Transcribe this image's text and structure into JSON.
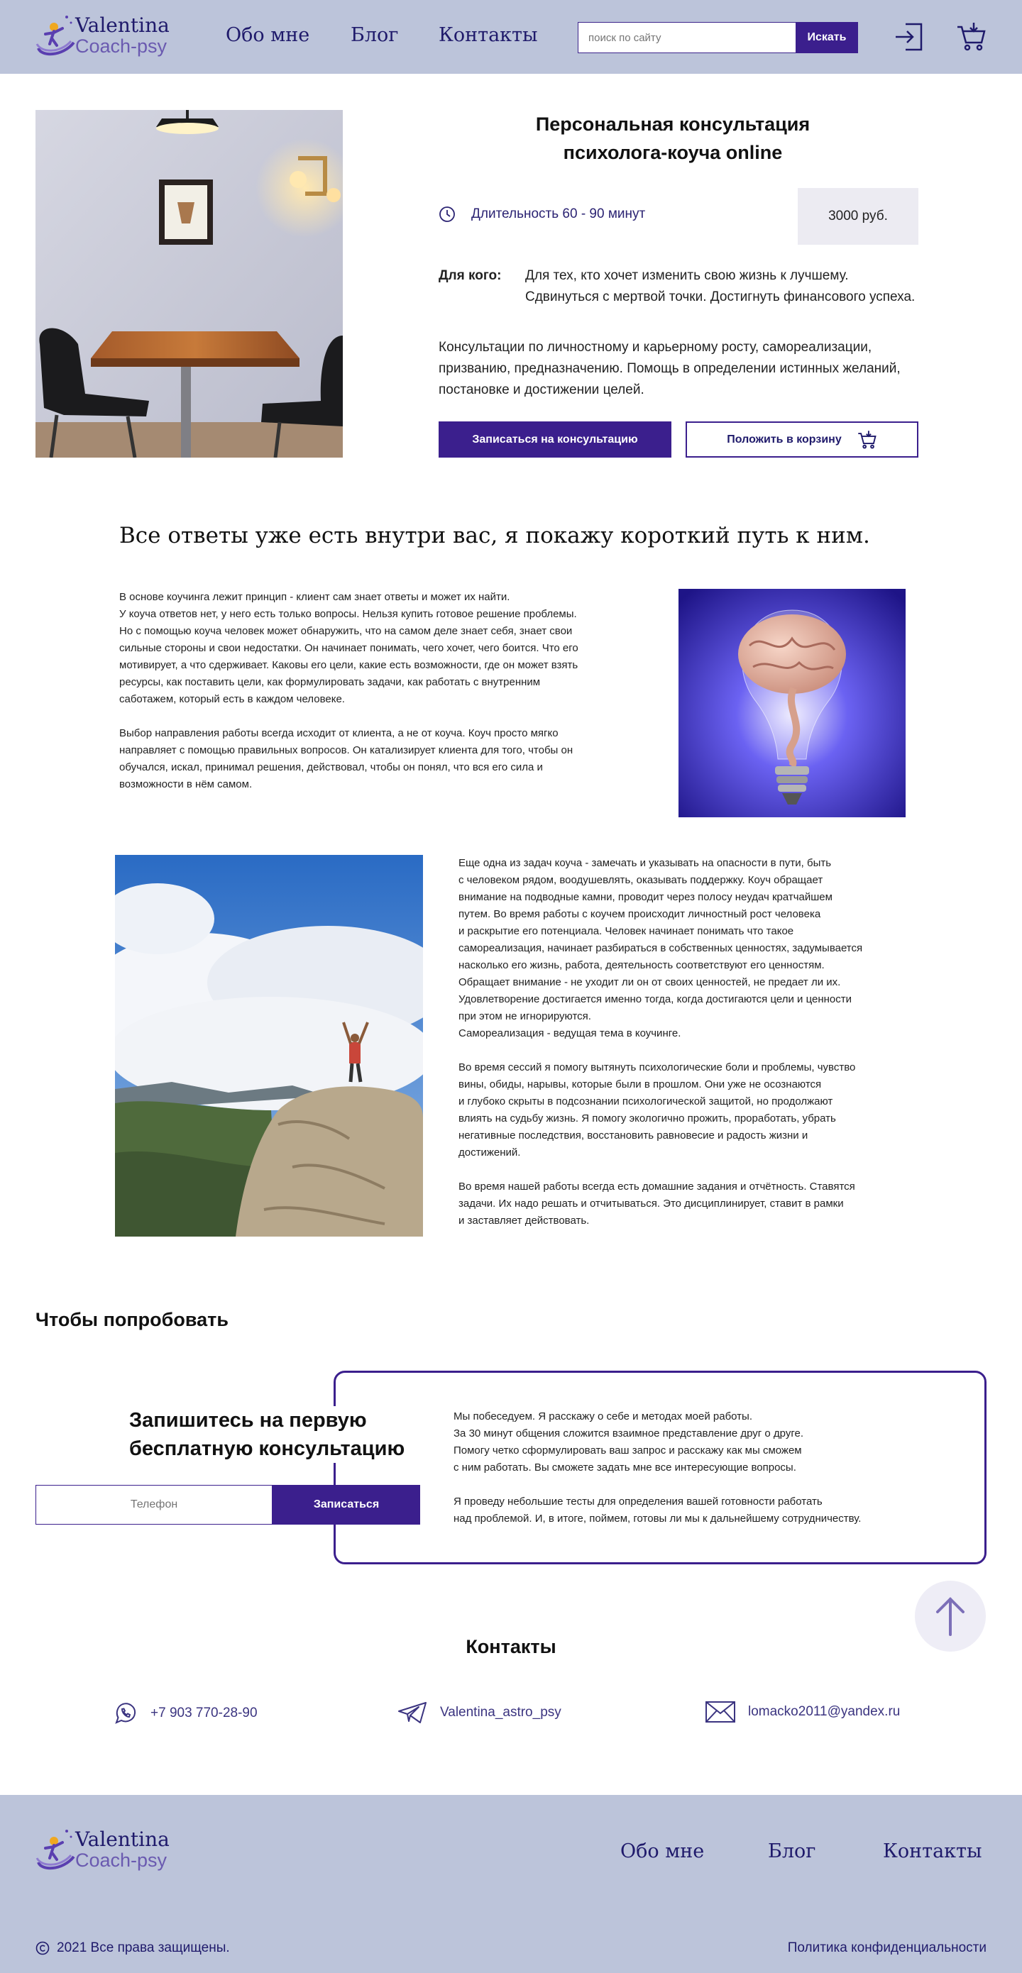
{
  "brand": {
    "name_line1": "Valentina",
    "name_line2": "Coach-psy"
  },
  "nav": {
    "about": "Обо мне",
    "blog": "Блог",
    "contacts": "Контакты"
  },
  "search": {
    "placeholder": "поиск по сайту",
    "button": "Искать"
  },
  "product": {
    "title_line1": "Персональная консультация",
    "title_line2": "психолога-коуча online",
    "duration": "Длительность 60 - 90 минут",
    "price": "3000 руб.",
    "for_whom_label": "Для кого:",
    "for_whom_text": "Для тех, кто хочет изменить свою жизнь к лучшему. Сдвинуться с мертвой точки. Достигнуть финансового успеха.",
    "description": "Консультации по личностному и карьерному росту, самореализации, призванию, предназначению. Помощь в определении истинных желаний, постановке и достижении целей.",
    "book_button": "Записаться на консультацию",
    "cart_button": "Положить в корзину"
  },
  "about": {
    "heading": "Все ответы уже есть внутри вас,  я покажу короткий путь к ним.",
    "para1": "В основе коучинга лежит принцип - клиент сам знает ответы и может их найти.\n У коуча ответов нет, у него есть только вопросы. Нельзя купить готовое решение проблемы.\nНо с помощью коуча человек может обнаружить, что на самом деле знает себя, знает свои\nсильные стороны и свои недостатки. Он начинает понимать, чего хочет, чего боится. Что его\nмотивирует, а что сдерживает. Каковы его цели, какие есть возможности, где он может взять\nресурсы, как поставить цели, как формулировать задачи, как работать с внутренним\nсаботажем, который есть в каждом человеке.",
    "para2": "Выбор направления работы всегда исходит от клиента, а не от коуча. Коуч просто мягко\nнаправляет с помощью правильных вопросов. Он катализирует клиента для того, чтобы он\nобучался, искал, принимал решения, действовал, чтобы он понял, что вся его сила и\nвозможности в нём самом.",
    "para3": "Еще одна из задач коуча - замечать и указывать на опасности в пути, быть\nс человеком рядом, воодушевлять, оказывать поддержку. Коуч обращает\nвнимание на подводные камни, проводит через полосу неудач кратчайшем\nпутем.  Во время работы с коучем происходит личностный рост человека\n и раскрытие его потенциала. Человек начинает понимать что такое\nсамореализация, начинает разбираться в собственных ценностях, задумывается\nнасколько его жизнь, работа, деятельность соответствуют его ценностям.\nОбращает внимание  - не уходит ли он от своих ценностей, не предает ли их.\nУдовлетворение достигается именно тогда, когда достигаются цели и ценности\nпри этом не игнорируются.\nСамореализация - ведущая тема в коучинге.",
    "para4": "Во время сессий я помогу вытянуть психологические боли и проблемы, чувство\nвины, обиды, нарывы, которые были в прошлом. Они уже не осознаются\nи глубоко скрыты в подсознании психологической защитой, но продолжают\nвлиять на судьбу жизнь. Я помогу экологично прожить, проработать, убрать\nнегативные последствия, восстановить равновесие и радость жизни и\nдостижений.",
    "para5": "Во время нашей работы всегда есть домашние задания и отчётность. Ставятся\nзадачи. Их надо решать и отчитываться. Это  дисциплинирует, ставит в рамки\nи заставляет действовать."
  },
  "trial": {
    "section_title": "Чтобы попробовать",
    "heading_line1": "Запишитесь на первую",
    "heading_line2": "бесплатную консультацию",
    "phone_placeholder": "Телефон",
    "submit": "Записаться",
    "text1": "Мы побеседуем. Я расскажу о себе и методах моей работы.\nЗа 30 минут общения сложится взаимное представление друг о друге.\nПомогу четко сформулировать ваш запрос и расскажу как мы сможем\nс ним работать. Вы сможете задать мне все интересующие вопросы.",
    "text2": "Я проведу небольшие тесты для определения вашей готовности работать\nнад проблемой. И, в итоге, поймем, готовы ли мы к дальнейшему сотрудничеству."
  },
  "contacts": {
    "title": "Контакты",
    "phone": "+7 903 770-28-90",
    "telegram": "Valentina_astro_psy",
    "email": "lomacko2011@yandex.ru"
  },
  "footer": {
    "copyright": "2021  Все права защищены.",
    "privacy": "Политика конфиденциальности"
  },
  "colors": {
    "accent": "#3b1f8d",
    "header_bg": "#bcc4da",
    "nav_text": "#1f1a6b"
  },
  "icons": [
    "logo-icon",
    "login-icon",
    "cart-icon",
    "clock-icon",
    "cart-small-icon",
    "arrow-up-icon",
    "whatsapp-icon",
    "telegram-icon",
    "mail-icon",
    "copyright-icon"
  ]
}
